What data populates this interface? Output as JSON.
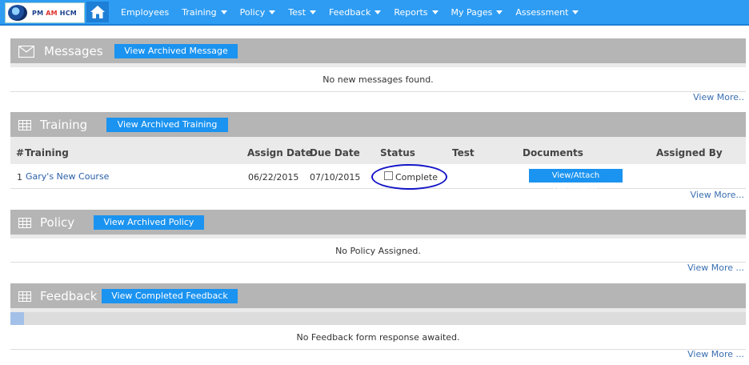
{
  "nav": {
    "logo_text_pm": "PM",
    "logo_text_am": "AM",
    "logo_text_hcm": "HCM",
    "items": [
      {
        "label": "Employees",
        "dropdown": false
      },
      {
        "label": "Training",
        "dropdown": true
      },
      {
        "label": "Policy",
        "dropdown": true
      },
      {
        "label": "Test",
        "dropdown": true
      },
      {
        "label": "Feedback",
        "dropdown": true
      },
      {
        "label": "Reports",
        "dropdown": true
      },
      {
        "label": "My Pages",
        "dropdown": true
      },
      {
        "label": "Assessment",
        "dropdown": true
      }
    ],
    "bar_color": "#2e9cf3"
  },
  "messages": {
    "title": "Messages",
    "button": "View Archived Message",
    "empty": "No new messages found.",
    "view_more": "View More.."
  },
  "training": {
    "title": "Training",
    "button": "View Archived Training",
    "columns": [
      "#",
      "Training",
      "Assign Date",
      "Due Date",
      "Status",
      "Test",
      "Documents",
      "Assigned By"
    ],
    "rows": [
      {
        "num": "1",
        "training": "Gary's New Course",
        "assign_date": "06/22/2015",
        "due_date": "07/10/2015",
        "status": "Complete",
        "test": "",
        "documents_button": "View/Attach Documents",
        "assigned_by": ""
      }
    ],
    "view_more": "View More..."
  },
  "policy": {
    "title": "Policy",
    "button": "View Archived Policy",
    "empty": "No Policy Assigned.",
    "view_more": "View More ..."
  },
  "feedback": {
    "title": "Feedback",
    "button": "View Completed Feedback",
    "empty": "No Feedback form response awaited.",
    "view_more": "View More ...",
    "progress_fraction": 0.018
  },
  "colors": {
    "section_header": "#b5b5b5",
    "button": "#1b93f0",
    "link": "#2a5fa8",
    "highlight_circle": "#1414c8"
  }
}
